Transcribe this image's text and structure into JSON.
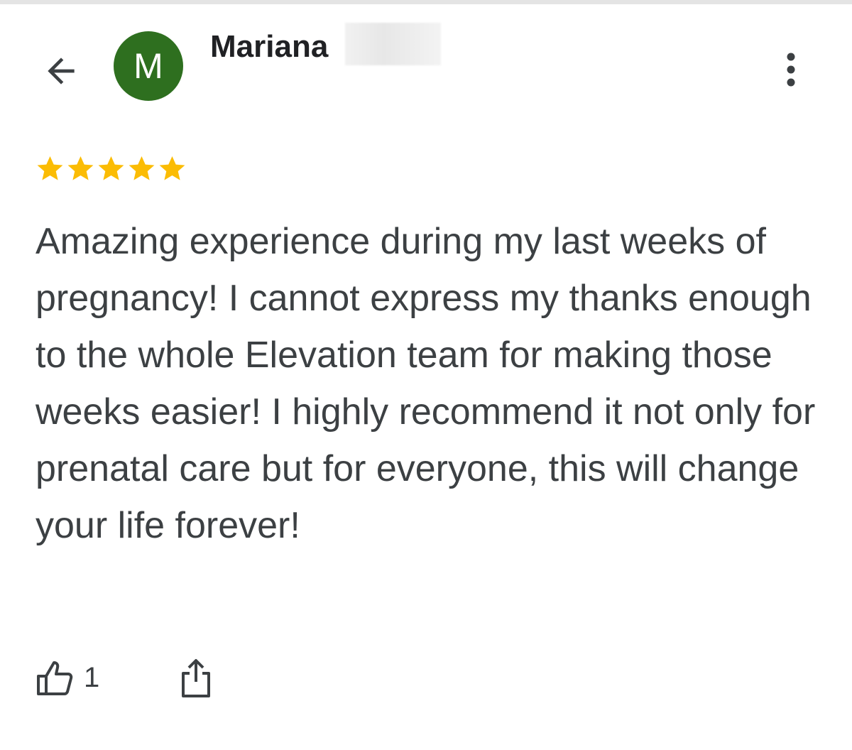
{
  "review": {
    "author": {
      "initial": "M",
      "name": "Mariana",
      "avatar_color": "#2e6f1f"
    },
    "rating": 5,
    "rating_max": 5,
    "star_color": "#fbbc04",
    "text": "Amazing experience during my last weeks of pregnancy! I cannot express my thanks enough to the whole Elevation team for making those weeks easier! I highly recommend it not only for prenatal care but for everyone, this will change your life forever!",
    "like_count": "1"
  },
  "icons": {
    "back": "arrow-back-icon",
    "more": "more-vert-icon",
    "like": "thumb-up-outline-icon",
    "share": "share-icon",
    "star": "star-icon"
  }
}
